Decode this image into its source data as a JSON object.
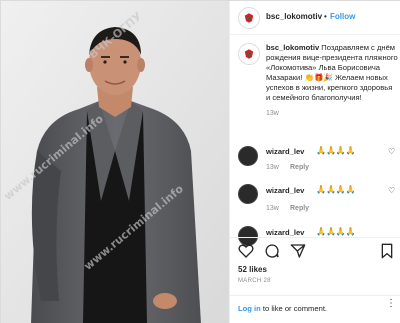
{
  "post": {
    "username": "bsc_lokomotiv",
    "separator": "•",
    "follow_label": "Follow",
    "caption_username": "bsc_lokomotiv",
    "caption_text": "Поздравляем с днём рождения вице-президента пляжного «Локомотива» Льва Борисовича Мазараки! 👏🎁🎉 Желаем новых успехов в жизни, крепкого здоровья и семейного благополучия!",
    "caption_time": "13w",
    "likes": "52 likes",
    "date": "MARCH 28"
  },
  "comments": [
    {
      "username": "wizard_lev",
      "emoji": "🙏🙏🙏🙏",
      "time": "13w",
      "reply_label": "Reply"
    },
    {
      "username": "wizard_lev",
      "emoji": "🙏🙏🙏🙏",
      "time": "13w",
      "reply_label": "Reply"
    },
    {
      "username": "wizard_lev",
      "emoji": "🙏🙏🙏🙏"
    }
  ],
  "footer": {
    "login_label": "Log in",
    "rest_text": " to like or comment."
  },
  "icons": {
    "heart": "heart-icon",
    "comment": "comment-icon",
    "share": "share-icon",
    "save": "bookmark-icon",
    "more": "more-icon"
  },
  "watermarks": [
    "ВЧК-ОГПУ",
    "www.rucriminal.info",
    "www.rucriminal.info"
  ],
  "colors": {
    "link_blue": "#3897f0",
    "text": "#262626",
    "muted": "#8e8e8e",
    "border": "#dbdbdb",
    "lokomotiv_red": "#d4202a"
  }
}
